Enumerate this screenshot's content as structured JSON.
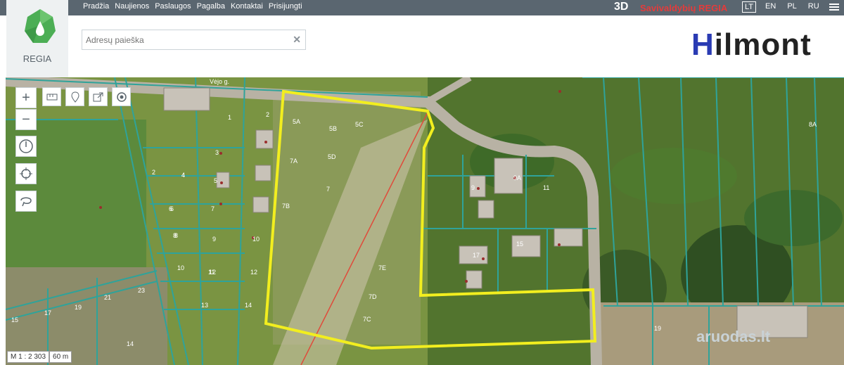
{
  "nav": {
    "items": [
      "Pradžia",
      "Naujienos",
      "Paslaugos",
      "Pagalba",
      "Kontaktai",
      "Prisijungti"
    ],
    "btn3d": "3D",
    "brand": "Savivaldybių REGIA",
    "langs": [
      "LT",
      "EN",
      "PL",
      "RU"
    ],
    "active_lang": "LT"
  },
  "logo": {
    "label": "REGIA"
  },
  "search": {
    "placeholder": "Adresų paieška"
  },
  "brand_logo": {
    "first": "H",
    "rest": "ilmont"
  },
  "map": {
    "street": "Vėjo g.",
    "scale": "M 1 : 2 303",
    "scale_bar": "60 m",
    "watermark": "aruodas.lt",
    "highlight_color": "#f2ee1f",
    "parcel_line_color": "#2fa39a",
    "parcel_labels": [
      "1",
      "2",
      "3",
      "4",
      "5",
      "6",
      "7",
      "8",
      "9",
      "10",
      "11",
      "12",
      "13",
      "14",
      "15",
      "17",
      "19",
      "21",
      "23",
      "2",
      "4",
      "6",
      "8",
      "10",
      "12",
      "14",
      "5A",
      "5B",
      "5C",
      "5D",
      "7A",
      "7B",
      "7",
      "7E",
      "7D",
      "7C",
      "9",
      "9A",
      "11",
      "15",
      "17",
      "19",
      "8A"
    ]
  },
  "tools": [
    "zoom-in",
    "zoom-out",
    "measure",
    "location",
    "share",
    "target",
    "compass",
    "crosshair",
    "lasso"
  ]
}
